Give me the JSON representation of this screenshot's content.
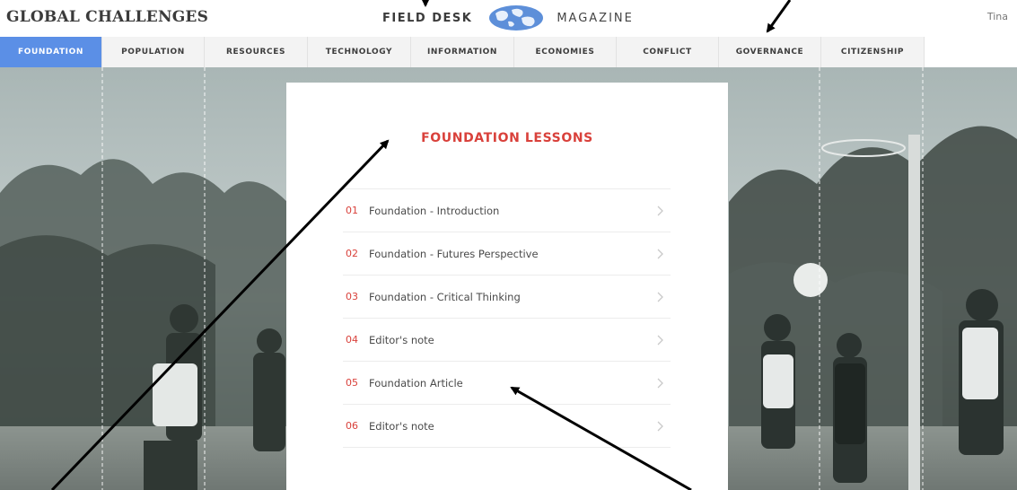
{
  "header": {
    "site_title": "GLOBAL CHALLENGES",
    "brand_left": "FIELD DESK",
    "brand_right": "MAGAZINE",
    "logo_icon": "globe-icon",
    "user_name": "Tina"
  },
  "nav": {
    "tabs": [
      {
        "label": "FOUNDATION",
        "active": true
      },
      {
        "label": "POPULATION",
        "active": false
      },
      {
        "label": "RESOURCES",
        "active": false
      },
      {
        "label": "TECHNOLOGY",
        "active": false
      },
      {
        "label": "INFORMATION",
        "active": false
      },
      {
        "label": "ECONOMIES",
        "active": false
      },
      {
        "label": "CONFLICT",
        "active": false
      },
      {
        "label": "GOVERNANCE",
        "active": false
      },
      {
        "label": "CITIZENSHIP",
        "active": false
      }
    ]
  },
  "lessons_card": {
    "title": "FOUNDATION LESSONS",
    "items": [
      {
        "number": "01",
        "label": "Foundation - Introduction"
      },
      {
        "number": "02",
        "label": "Foundation - Futures Perspective"
      },
      {
        "number": "03",
        "label": "Foundation - Critical Thinking"
      },
      {
        "number": "04",
        "label": "Editor's note"
      },
      {
        "number": "05",
        "label": "Foundation Article"
      },
      {
        "number": "06",
        "label": "Editor's note"
      }
    ],
    "chevron_icon": "chevron-right-icon"
  },
  "colors": {
    "accent_red": "#d9413b",
    "active_tab_blue": "#5b8fe6",
    "nav_background": "#f3f3f3",
    "hero_tint": "#8a9a98"
  }
}
